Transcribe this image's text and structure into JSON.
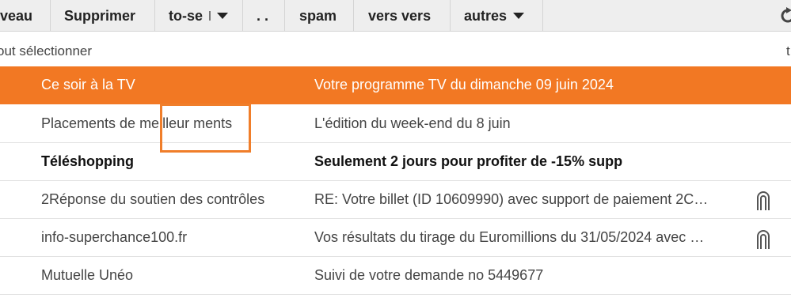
{
  "toolbar": {
    "buttons": [
      {
        "label": "veau"
      },
      {
        "label": "Supprimer"
      },
      {
        "label": "to-se"
      },
      {
        "label": ". ."
      },
      {
        "label": "spam"
      },
      {
        "label": "vers vers"
      },
      {
        "label": "autres"
      }
    ],
    "refresh_icon": "refresh-icon"
  },
  "select_bar": {
    "label": "out sélectionner",
    "right_text": "t"
  },
  "messages": [
    {
      "sender": "Ce soir à la TV",
      "subject": "Votre programme TV du dimanche 09 juin 2024",
      "attachment": false,
      "highlighted": true
    },
    {
      "sender": "Placements de meilleur ments",
      "subject": "L'édition du week-end du 8 juin",
      "attachment": false
    },
    {
      "sender": "Téléshopping",
      "subject": "Seulement 2 jours pour profiter de -15% supp",
      "attachment": false,
      "unread": true
    },
    {
      "sender": "2Réponse du soutien des contrôles",
      "subject": "RE: Votre billet (ID 10609990) avec support de paiement 2C…",
      "attachment": true
    },
    {
      "sender": "info-superchance100.fr",
      "subject": "Vos résultats du tirage du Euromillions du 31/05/2024 avec …",
      "attachment": true
    },
    {
      "sender": "Mutuelle Unéo",
      "subject": "Suivi de votre demande no 5449677",
      "attachment": false
    }
  ],
  "colors": {
    "highlight": "#f27823",
    "annotation_box": "#f07e2a",
    "toolbar_bg": "#eeeeee"
  }
}
